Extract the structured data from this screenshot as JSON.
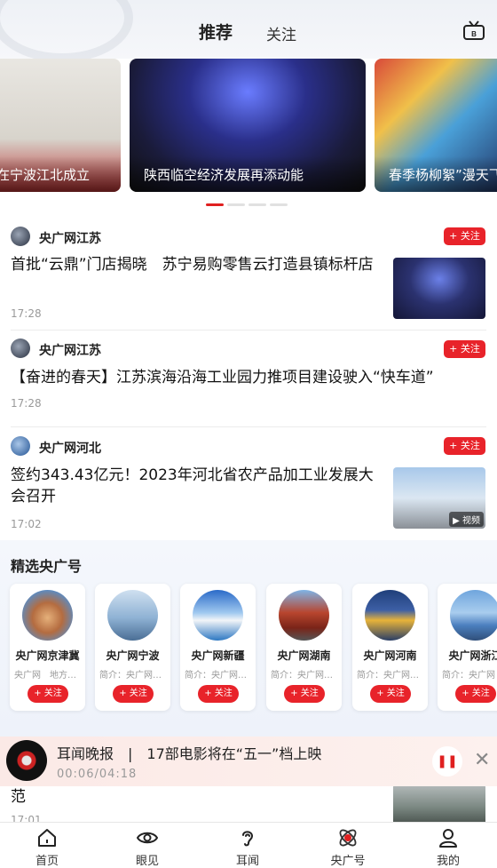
{
  "header": {
    "tabs": [
      "推荐",
      "关注"
    ],
    "right_icon": "broadcast-icon"
  },
  "carousel": {
    "slides": [
      {
        "caption": "在宁波江北成立"
      },
      {
        "caption": "陕西临空经济发展再添动能"
      },
      {
        "caption": "春季杨柳絮”漫天飞"
      }
    ],
    "active_index": 0,
    "dot_count": 4
  },
  "news": [
    {
      "source": "央广网江苏",
      "follow": "+ 关注",
      "title": "首批“云鼎”门店揭晓　苏宁易购零售云打造县镇标杆店",
      "time": "17:28"
    },
    {
      "source": "央广网江苏",
      "follow": "+ 关注",
      "title": "【奋进的春天】江苏滨海沿海工业园力推项目建设驶入“快车道”",
      "time": "17:28"
    },
    {
      "source": "央广网河北",
      "follow": "+ 关注",
      "title": "签约343.43亿元！2023年河北省农产品加工业发展大会召开",
      "time": "17:02",
      "video_tag": "视频"
    }
  ],
  "featured": {
    "title": "精选央广号",
    "cards": [
      {
        "name": "央广网京津冀",
        "desc": "央广网　地方…",
        "follow": "+ 关注"
      },
      {
        "name": "央广网宁波",
        "desc": "简介：央广网…",
        "follow": "+ 关注"
      },
      {
        "name": "央广网新疆",
        "desc": "简介：央广网…",
        "follow": "+ 关注"
      },
      {
        "name": "央广网湖南",
        "desc": "简介：央广网…",
        "follow": "+ 关注"
      },
      {
        "name": "央广网河南",
        "desc": "简介：央广网…",
        "follow": "+ 关注"
      },
      {
        "name": "央广网浙江",
        "desc": "简介：央广网",
        "follow": "+ 关注"
      }
    ]
  },
  "under_player": {
    "text": "范",
    "time": "17:01"
  },
  "player": {
    "title": "耳闻晚报　|　17部电影将在“五一”档上映",
    "time": "00:06/04:18"
  },
  "bottom_nav": [
    {
      "label": "首页",
      "icon": "home-icon"
    },
    {
      "label": "眼见",
      "icon": "eye-icon"
    },
    {
      "label": "耳闻",
      "icon": "ear-icon"
    },
    {
      "label": "央广号",
      "icon": "cnr-logo-icon"
    },
    {
      "label": "我的",
      "icon": "user-icon"
    }
  ],
  "colors": {
    "accent": "#e8232a",
    "text": "#222222",
    "muted": "#999999"
  }
}
